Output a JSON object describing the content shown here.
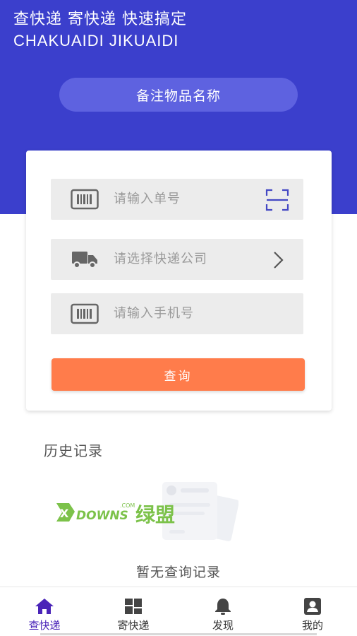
{
  "header": {
    "slogan_cn": "查快递  寄快递  快速搞定",
    "slogan_en": "CHAKUAIDI  JIKUAIDI",
    "note_button": "备注物品名称"
  },
  "form": {
    "tracking_placeholder": "请输入单号",
    "company_placeholder": "请选择快递公司",
    "phone_placeholder": "请输入手机号",
    "query_button": "查询"
  },
  "history": {
    "title": "历史记录",
    "empty_text": "暂无查询记录"
  },
  "watermark": {
    "brand": "DOWNS",
    "brand_cn": "绿盟",
    "domain": ".COM"
  },
  "tabs": [
    {
      "label": "查快递",
      "icon": "home-icon",
      "active": true
    },
    {
      "label": "寄快递",
      "icon": "grid-icon",
      "active": false
    },
    {
      "label": "发现",
      "icon": "bell-icon",
      "active": false
    },
    {
      "label": "我的",
      "icon": "profile-icon",
      "active": false
    }
  ],
  "colors": {
    "primary": "#3b3fcc",
    "pill": "#5e62e0",
    "accent": "#ff7c4b",
    "tab_active": "#4a24b8"
  }
}
